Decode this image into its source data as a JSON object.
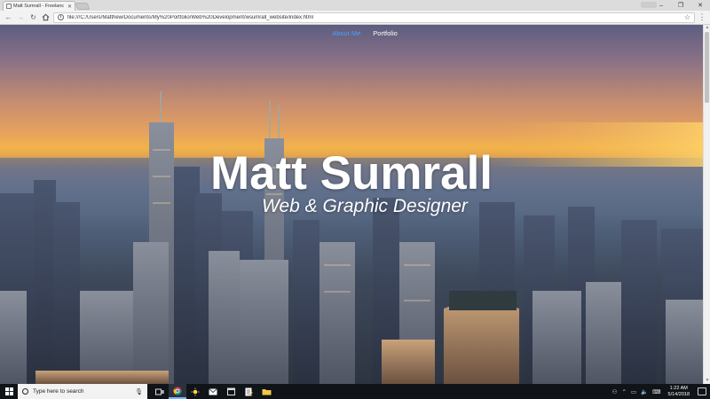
{
  "browser": {
    "tab_title": "Matt Sumrall - Freelanc",
    "url": "file:///C:/Users/Matthew/Documents/My%20Portfolio/Web%20Development/wsumrall_website/index.html"
  },
  "site": {
    "nav": [
      {
        "label": "About Me",
        "active": true
      },
      {
        "label": "Portfolio",
        "active": false
      }
    ],
    "hero_name": "Matt Sumrall",
    "hero_subtitle": "Web & Graphic Designer"
  },
  "taskbar": {
    "search_placeholder": "Type here to search",
    "time": "1:22 AM",
    "date": "5/14/2018"
  },
  "colors": {
    "nav_active": "#4aa3ff",
    "nav_inactive": "#ffffff"
  }
}
